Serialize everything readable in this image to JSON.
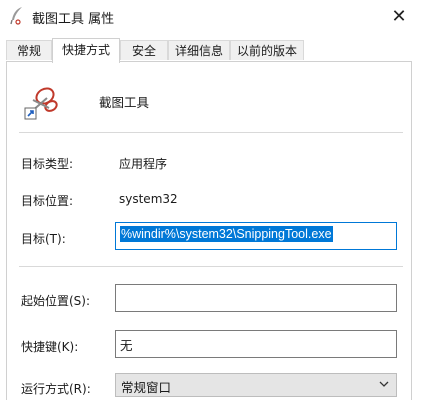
{
  "window": {
    "title": "截图工具 属性",
    "close_glyph": "✕",
    "title_icon": "feather-scissors-icon"
  },
  "tabs": [
    {
      "label": "常规",
      "active": false
    },
    {
      "label": "快捷方式",
      "active": true
    },
    {
      "label": "安全",
      "active": false
    },
    {
      "label": "详细信息",
      "active": false
    },
    {
      "label": "以前的版本",
      "active": false
    }
  ],
  "app": {
    "name": "截图工具",
    "icon": "scissors-shortcut-icon"
  },
  "fields": {
    "target_type": {
      "label": "目标类型:",
      "value": "应用程序"
    },
    "target_location": {
      "label": "目标位置:",
      "value": "system32"
    },
    "target": {
      "label": "目标(T):",
      "value": "%windir%\\system32\\SnippingTool.exe"
    },
    "start_in": {
      "label": "起始位置(S):",
      "value": ""
    },
    "shortcut_key": {
      "label": "快捷键(K):",
      "value": "无"
    },
    "run": {
      "label": "运行方式(R):",
      "value": "常规窗口"
    }
  },
  "colors": {
    "accent": "#0078d7",
    "border": "#d0d0d0"
  }
}
